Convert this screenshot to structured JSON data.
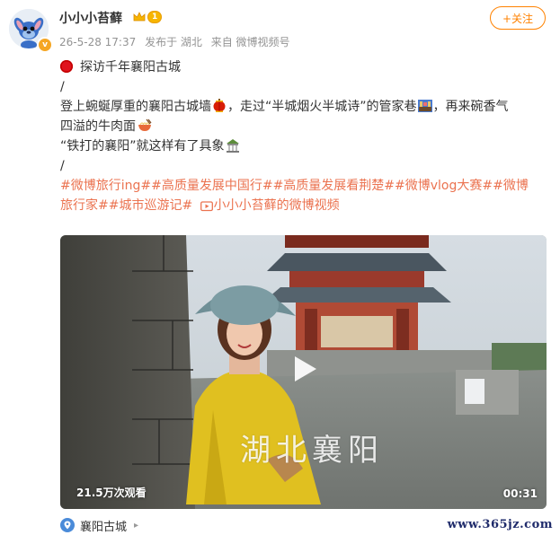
{
  "user": {
    "name": "小小小苔藓",
    "vip_level": "1",
    "verified_mark": "v"
  },
  "meta": {
    "time": "26-5-28 17:37",
    "location": "发布于 湖北",
    "source": "来自 微博视频号"
  },
  "follow_label": "+关注",
  "post": {
    "title": "探访千年襄阳古城",
    "divider": "/",
    "line1": "登上蜿蜒厚重的襄阳古城墙",
    "line1b": "，走过“半城烟火半城诗”的管家巷",
    "line1c": "，再来碗香气",
    "line2": "四溢的牛肉面",
    "line3": "“铁打的襄阳”就这样有了具象",
    "tags_line1": "#微博旅行ing##高质量发展中国行##高质量发展看荆楚##微博vlog大赛##微博",
    "tags_line2": "旅行家##城市巡游记#",
    "video_link": "小小小苔藓的微博视频"
  },
  "video": {
    "views": "21.5万次观看",
    "duration": "00:31",
    "overlay_text": "湖北襄阳"
  },
  "place": {
    "name": "襄阳古城"
  },
  "watermark": "www.365jz.com",
  "colors": {
    "accent": "#ff8200",
    "tag": "#eb7350",
    "meta": "#939393"
  }
}
